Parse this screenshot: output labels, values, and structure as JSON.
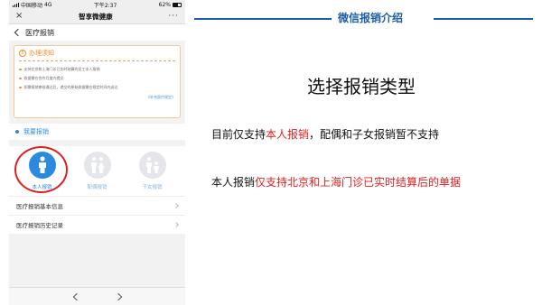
{
  "phone": {
    "status": {
      "carrier": "中国移动",
      "network": "4G",
      "time": "下午2:37",
      "battery": "62%"
    },
    "wx_bar": {
      "close": "×",
      "title": "智享微健康",
      "more": "···"
    },
    "nav": {
      "title": "医疗报销"
    },
    "notice": {
      "title": "办理须知",
      "items": [
        "支持北京和上海门诊已实时结算的员工本人报销",
        "收据需在合作月度内提交",
        "如需报销审核通过后，递交的原始收据需在规定时间内送达"
      ],
      "link": "《补充医疗规定》"
    },
    "section": {
      "label": "我要报销"
    },
    "types": [
      {
        "label": "本人报销",
        "state": "active"
      },
      {
        "label": "配偶报销",
        "state": "inactive"
      },
      {
        "label": "子女报销",
        "state": "inactive"
      }
    ],
    "menu": [
      {
        "label": "医疗报销基本信息"
      },
      {
        "label": "医疗报销历史记录"
      }
    ],
    "bottom_nav": {
      "back": "‹",
      "forward": "›"
    }
  },
  "slide": {
    "header": "微信报销介绍",
    "title": "选择报销类型",
    "line1": {
      "before": "目前仅支持",
      "highlight": "本人报销",
      "after": "，配偶和子女报销暂不支持"
    },
    "line2": {
      "before": "本人报销",
      "highlight": "仅支持北京和上海门诊已实时结算后的单据",
      "after": ""
    }
  },
  "colors": {
    "accent": "#2a8ae0",
    "header_blue": "#1f5ea8",
    "highlight_red": "#e02020",
    "notice_orange": "#f08a2a"
  }
}
